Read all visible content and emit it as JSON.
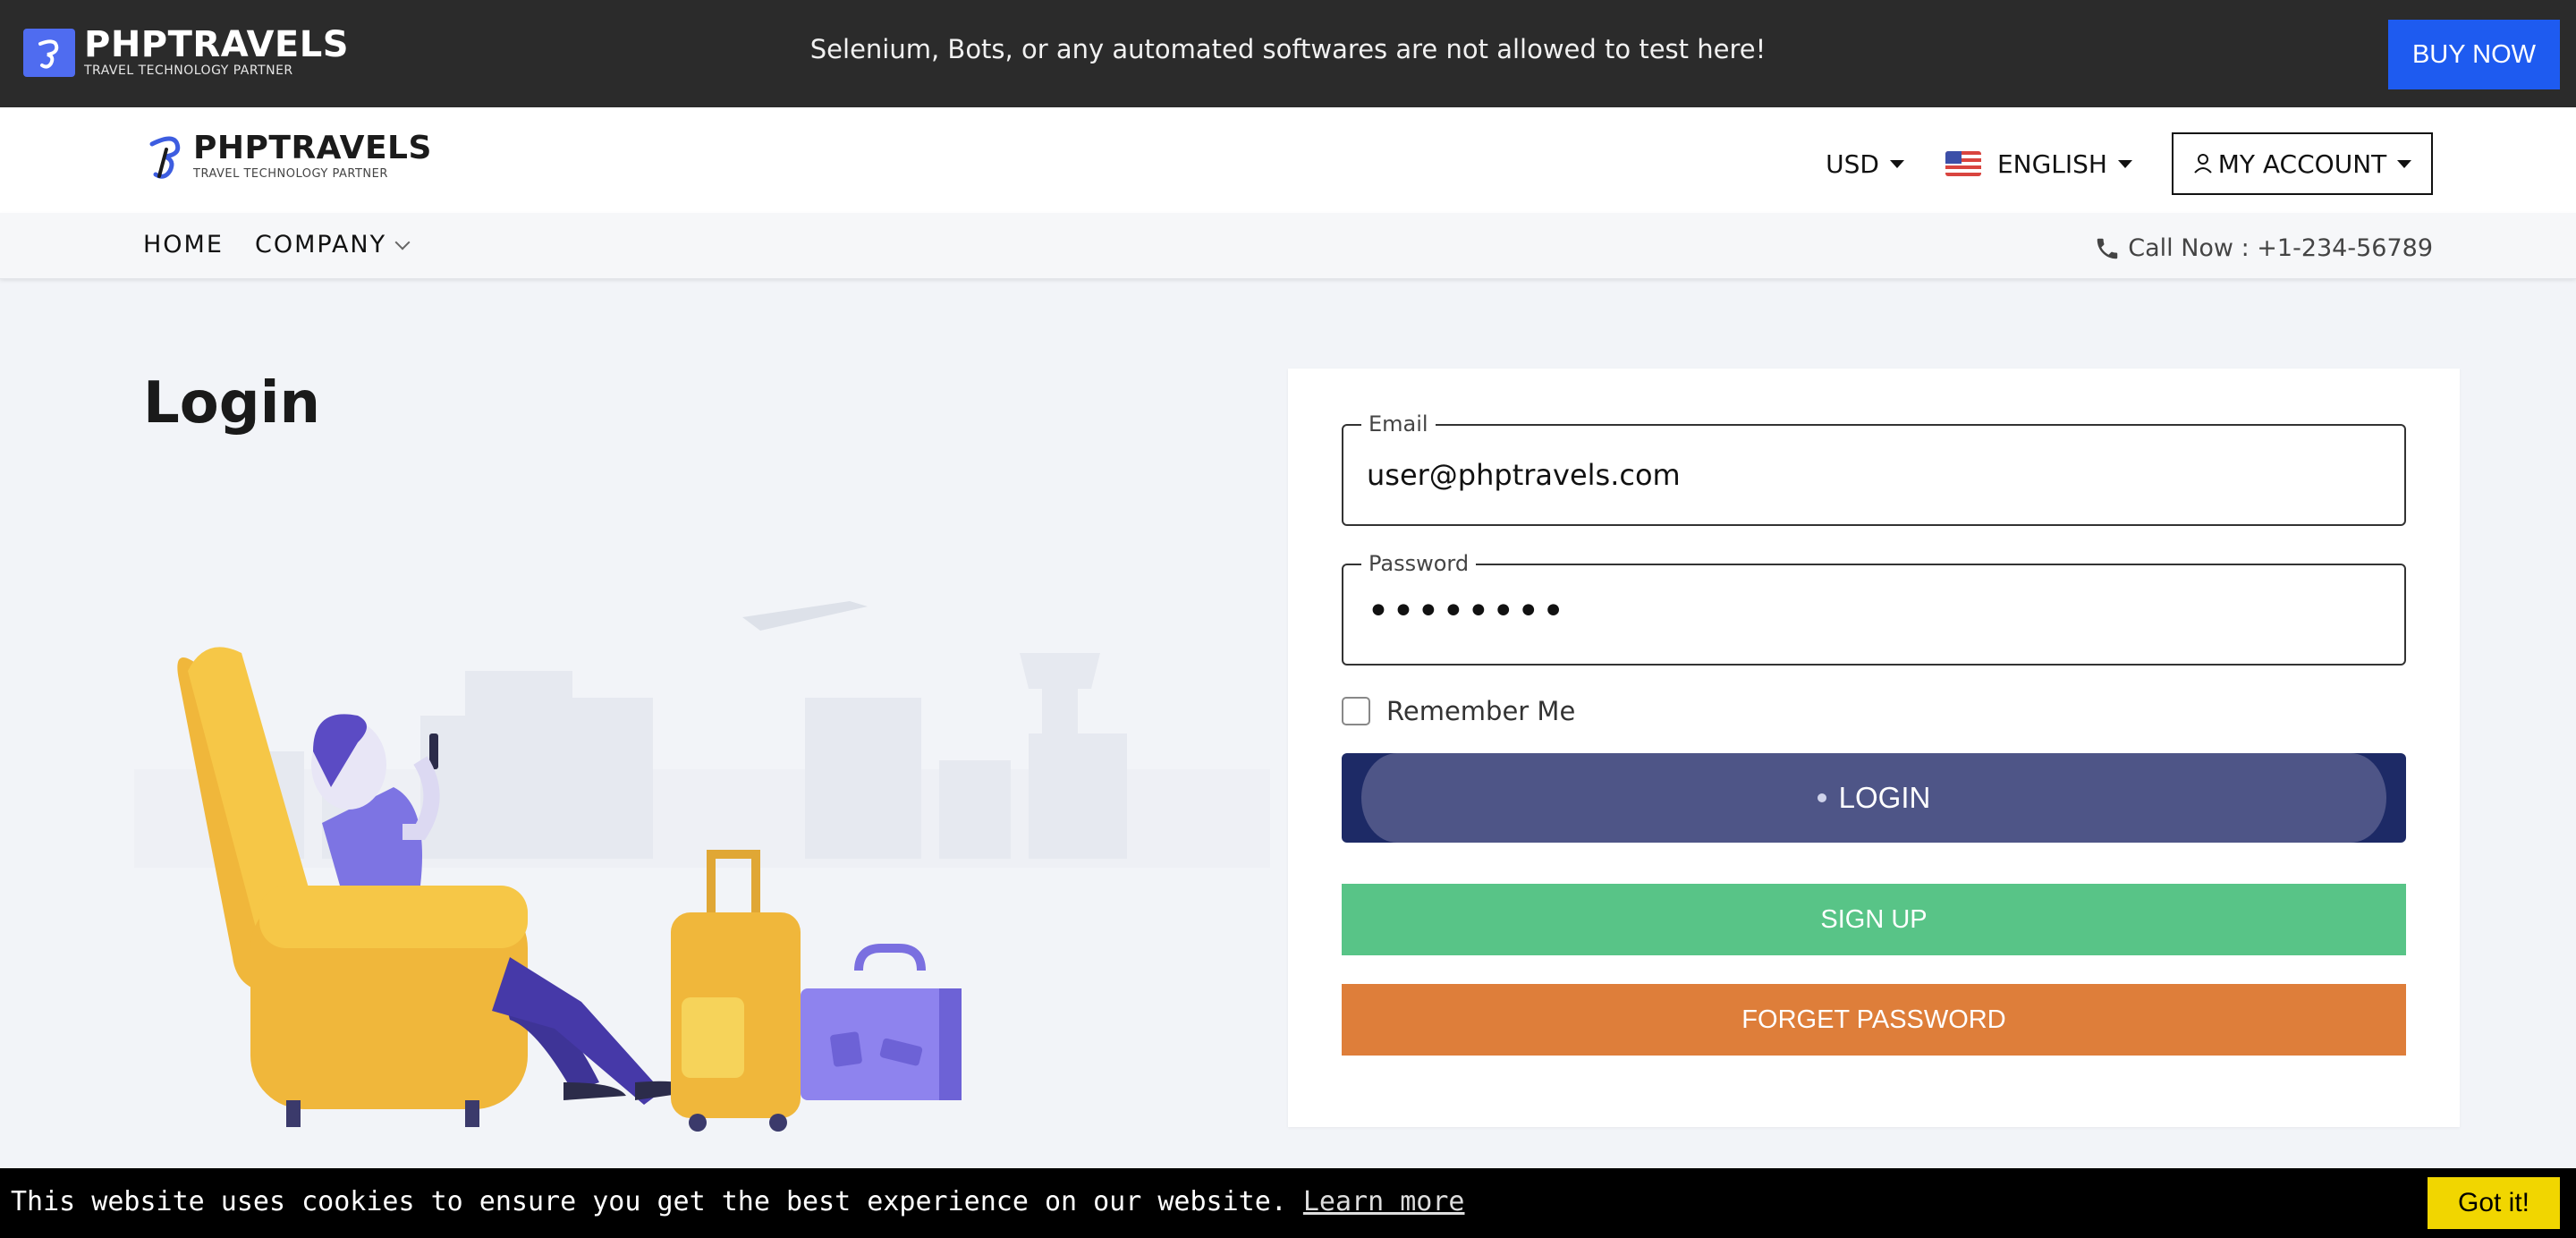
{
  "topbar": {
    "brand_name": "PHPTRAVELS",
    "brand_tagline": "TRAVEL TECHNOLOGY PARTNER",
    "notice": "Selenium, Bots, or any automated softwares are not allowed to test here!",
    "buy_now_label": "BUY NOW"
  },
  "header": {
    "brand_name": "PHPTRAVELS",
    "brand_tagline": "TRAVEL TECHNOLOGY PARTNER",
    "currency": "USD",
    "language": "ENGLISH",
    "account_label": "MY ACCOUNT"
  },
  "nav": {
    "items": [
      {
        "label": "HOME"
      },
      {
        "label": "COMPANY"
      }
    ],
    "call_text": "Call Now : +1-234-56789"
  },
  "main": {
    "title": "Login"
  },
  "login_form": {
    "email_label": "Email",
    "email_value": "user@phptravels.com",
    "password_label": "Password",
    "password_value": "••••••••",
    "remember_label": "Remember Me",
    "remember_checked": false,
    "login_label": "LOGIN",
    "signup_label": "SIGN UP",
    "forget_label": "FORGET PASSWORD"
  },
  "cookie": {
    "message": "This website uses cookies to ensure you get the best experience on our website.",
    "learn_more": "Learn more",
    "accept_label": "Got it!"
  },
  "colors": {
    "topbar_bg": "#2b2b2b",
    "buy_now": "#1e5bf0",
    "login_button": "#1d2a66",
    "signup_button": "#58c487",
    "forget_button": "#de7e3a",
    "cookie_accept": "#f1d600"
  },
  "icons": [
    "logo-icon",
    "caret-down-icon",
    "us-flag-icon",
    "user-icon",
    "chevron-down-icon",
    "phone-icon"
  ]
}
